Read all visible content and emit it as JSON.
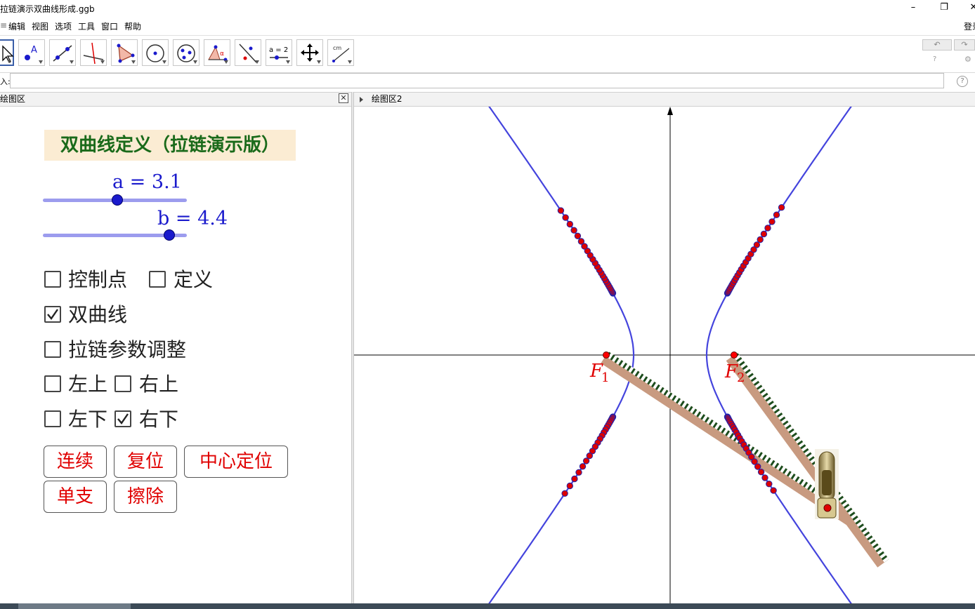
{
  "window": {
    "title": "拉链演示双曲线形成.ggb",
    "minimize": "–",
    "restore": "❐",
    "close": "✕"
  },
  "menu": {
    "items": [
      "编辑",
      "视图",
      "选项",
      "工具",
      "窗口",
      "帮助"
    ],
    "login": "登录"
  },
  "toolbar": {
    "tools": [
      "move-tool-icon",
      "point-tool-icon",
      "line-tool-icon",
      "perpendicular-tool-icon",
      "polygon-tool-icon",
      "circle-tool-icon",
      "conic-tool-icon",
      "angle-tool-icon",
      "reflect-tool-icon",
      "slider-tool-icon",
      "move-view-tool-icon",
      "measure-tool-icon"
    ],
    "slider_tool_text": "a = 2",
    "undo": "↶",
    "redo": "↷",
    "help": "?",
    "settings": "⚙"
  },
  "input_bar": {
    "label": "入:",
    "help": "?"
  },
  "left_panel": {
    "header": "绘图区",
    "close": "✕",
    "title": "双曲线定义（拉链演示版）",
    "slider_a": {
      "label": "a = 3.1",
      "value": 3.1,
      "min": 0,
      "max": 6
    },
    "slider_b": {
      "label": "b = 4.4",
      "value": 4.4,
      "min": 0,
      "max": 5
    },
    "checkboxes": [
      {
        "label": "控制点",
        "checked": false
      },
      {
        "label": "定义",
        "checked": false
      },
      {
        "label": "双曲线",
        "checked": true
      },
      {
        "label": "拉链参数调整",
        "checked": false
      },
      {
        "label": "左上",
        "checked": false
      },
      {
        "label": "右上",
        "checked": false
      },
      {
        "label": "左下",
        "checked": false
      },
      {
        "label": "右下",
        "checked": true
      }
    ],
    "buttons": [
      "连续",
      "复位",
      "中心定位",
      "单支",
      "擦除"
    ]
  },
  "right_panel": {
    "header": "绘图区2",
    "focus1_label": "F",
    "focus1_sub": "1",
    "focus2_label": "F",
    "focus2_sub": "2",
    "hyperbola_color": "#4444dd",
    "points_color": "#dd0000",
    "zipper_color": "#c89a80"
  },
  "status": {
    "thumb": ""
  }
}
